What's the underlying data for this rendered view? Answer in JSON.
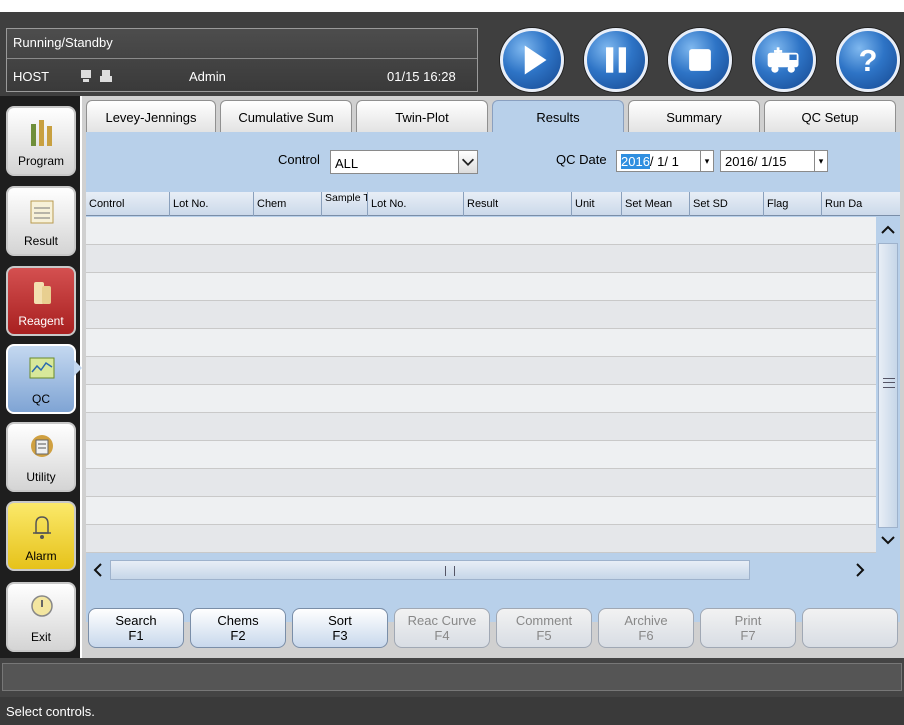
{
  "header": {
    "run_status": "Running/Standby",
    "host_label": "HOST",
    "user": "Admin",
    "datetime": "01/15 16:28"
  },
  "nav": {
    "items": [
      {
        "label": "Program",
        "icon": "program-icon"
      },
      {
        "label": "Result",
        "icon": "result-icon"
      },
      {
        "label": "Reagent",
        "icon": "reagent-icon"
      },
      {
        "label": "QC",
        "icon": "qc-icon"
      },
      {
        "label": "Utility",
        "icon": "utility-icon"
      },
      {
        "label": "Alarm",
        "icon": "bell-icon"
      },
      {
        "label": "Exit",
        "icon": "power-icon"
      }
    ]
  },
  "tabs": [
    {
      "label": "Levey-Jennings"
    },
    {
      "label": "Cumulative Sum"
    },
    {
      "label": "Twin-Plot"
    },
    {
      "label": "Results"
    },
    {
      "label": "Summary"
    },
    {
      "label": "QC Setup"
    }
  ],
  "active_tab": "Results",
  "filter": {
    "control_label": "Control",
    "control_value": "ALL",
    "qc_date_label": "QC Date",
    "date_from_year": "2016",
    "date_from_rest": "/  1/  1",
    "date_to": "2016/  1/15"
  },
  "table": {
    "columns": [
      "Control",
      "Lot No.",
      "Chem",
      "Sample Type",
      "Lot No.",
      "Result",
      "Unit",
      "Set Mean",
      "Set SD",
      "Flag",
      "Run Da"
    ],
    "rows": []
  },
  "function_keys": [
    {
      "label": "Search",
      "key": "F1",
      "enabled": true
    },
    {
      "label": "Chems",
      "key": "F2",
      "enabled": true
    },
    {
      "label": "Sort",
      "key": "F3",
      "enabled": true
    },
    {
      "label": "Reac Curve",
      "key": "F4",
      "enabled": false
    },
    {
      "label": "Comment",
      "key": "F5",
      "enabled": false
    },
    {
      "label": "Archive",
      "key": "F6",
      "enabled": false
    },
    {
      "label": "Print",
      "key": "F7",
      "enabled": false
    },
    {
      "label": "",
      "key": "",
      "enabled": false
    }
  ],
  "status_message": "Select controls.",
  "colors": {
    "panel_blue": "#b8d0ea",
    "dark_bg": "#3f3f3f",
    "accent_button": "#2e74c6",
    "reagent_red": "#a82020",
    "alarm_yellow": "#e6c21a"
  }
}
